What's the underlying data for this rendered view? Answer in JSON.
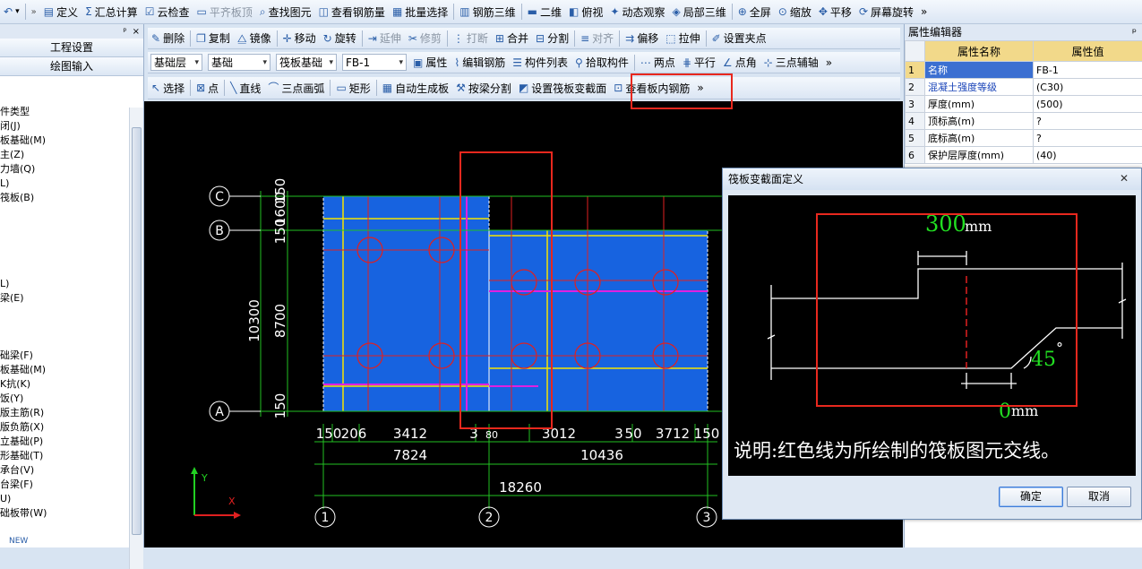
{
  "toolbar1": {
    "items": [
      {
        "label": "定义",
        "icon": "define-icon"
      },
      {
        "label": "汇总计算",
        "icon": "sigma-icon"
      },
      {
        "label": "云检查",
        "icon": "cloud-check-icon"
      },
      {
        "label": "平齐板顶",
        "icon": "align-top-icon",
        "disabled": true
      },
      {
        "label": "查找图元",
        "icon": "find-icon"
      },
      {
        "label": "查看钢筋量",
        "icon": "view-rebar-icon"
      },
      {
        "label": "批量选择",
        "icon": "batch-select-icon"
      },
      {
        "label": "钢筋三维",
        "icon": "rebar-3d-icon"
      },
      {
        "label": "二维",
        "icon": "2d-icon"
      },
      {
        "label": "俯视",
        "icon": "top-view-icon"
      },
      {
        "label": "动态观察",
        "icon": "orbit-icon"
      },
      {
        "label": "局部三维",
        "icon": "local-3d-icon"
      },
      {
        "label": "全屏",
        "icon": "fullscreen-icon"
      },
      {
        "label": "缩放",
        "icon": "zoom-icon"
      },
      {
        "label": "平移",
        "icon": "pan-icon"
      },
      {
        "label": "屏幕旋转",
        "icon": "rotate-screen-icon"
      }
    ],
    "more": "»"
  },
  "toolbar2": {
    "items": [
      {
        "label": "删除",
        "icon": "delete-icon"
      },
      {
        "label": "复制",
        "icon": "copy-icon"
      },
      {
        "label": "镜像",
        "icon": "mirror-icon"
      },
      {
        "label": "移动",
        "icon": "move-icon"
      },
      {
        "label": "旋转",
        "icon": "rotate-icon"
      },
      {
        "label": "延伸",
        "icon": "extend-icon",
        "disabled": true
      },
      {
        "label": "修剪",
        "icon": "trim-icon",
        "disabled": true
      },
      {
        "label": "打断",
        "icon": "break-icon",
        "disabled": true
      },
      {
        "label": "合并",
        "icon": "merge-icon"
      },
      {
        "label": "分割",
        "icon": "split-icon"
      },
      {
        "label": "对齐",
        "icon": "align-icon",
        "disabled": true
      },
      {
        "label": "偏移",
        "icon": "offset-icon"
      },
      {
        "label": "拉伸",
        "icon": "stretch-icon"
      },
      {
        "label": "设置夹点",
        "icon": "grip-icon"
      }
    ]
  },
  "toolbar3": {
    "floor": "基础层",
    "category": "基础",
    "type": "筏板基础",
    "element": "FB-1",
    "items": [
      {
        "label": "属性",
        "icon": "properties-icon"
      },
      {
        "label": "编辑钢筋",
        "icon": "edit-rebar-icon"
      },
      {
        "label": "构件列表",
        "icon": "component-list-icon"
      },
      {
        "label": "拾取构件",
        "icon": "pick-icon"
      },
      {
        "label": "两点",
        "icon": "two-point-icon"
      },
      {
        "label": "平行",
        "icon": "parallel-icon"
      },
      {
        "label": "点角",
        "icon": "point-angle-icon"
      },
      {
        "label": "三点辅轴",
        "icon": "three-point-axis-icon"
      }
    ],
    "more": "»"
  },
  "toolbar4": {
    "items": [
      {
        "label": "选择",
        "icon": "select-cursor-icon"
      },
      {
        "label": "点",
        "icon": "point-icon"
      },
      {
        "label": "直线",
        "icon": "line-icon"
      },
      {
        "label": "三点画弧",
        "icon": "arc-icon"
      },
      {
        "label": "矩形",
        "icon": "rectangle-icon"
      },
      {
        "label": "自动生成板",
        "icon": "auto-slab-icon"
      },
      {
        "label": "按梁分割",
        "icon": "split-by-beam-icon"
      },
      {
        "label": "设置筏板变截面",
        "icon": "variable-section-icon"
      },
      {
        "label": "查看板内钢筋",
        "icon": "view-slab-rebar-icon"
      }
    ],
    "more": "»"
  },
  "leftpanel": {
    "pin": "ᵖ",
    "close": "×",
    "nav": [
      "工程设置",
      "绘图输入"
    ],
    "tree": [
      "件类型",
      "闭(J)",
      "板基础(M)",
      "主(Z)",
      "力墙(Q)",
      "L)",
      "筏板(B)",
      "",
      "",
      "",
      "",
      "",
      "L)",
      "梁(E)",
      "",
      "",
      "",
      "础梁(F)",
      "板基础(M)",
      "K抗(K)",
      "饭(Y)",
      "版主筋(R)",
      "版负筋(X)",
      "立基础(P)",
      "形基础(T)",
      "承台(V)",
      "台梁(F)",
      "U)",
      "础板带(W)"
    ],
    "footer": "NEW"
  },
  "properties": {
    "title": "属性编辑器",
    "pin": "ᵖ",
    "headers": [
      "属性名称",
      "属性值"
    ],
    "rows": [
      {
        "n": "1",
        "name": "名称",
        "value": "FB-1",
        "highlight": false
      },
      {
        "n": "2",
        "name": "混凝土强度等级",
        "value": "(C30)",
        "highlight": true
      },
      {
        "n": "3",
        "name": "厚度(mm)",
        "value": "(500)",
        "highlight": false
      },
      {
        "n": "4",
        "name": "顶标高(m)",
        "value": "?",
        "highlight": false
      },
      {
        "n": "5",
        "name": "底标高(m)",
        "value": "?",
        "highlight": false
      },
      {
        "n": "6",
        "name": "保护层厚度(mm)",
        "value": "(40)",
        "highlight": false
      }
    ]
  },
  "drawing": {
    "axes_rows": [
      "C",
      "B",
      "A"
    ],
    "axes_cols": [
      "1",
      "2",
      "3"
    ],
    "vdims_outer": [
      "10300"
    ],
    "vdims_inner": [
      "1600",
      "150",
      "150",
      "8700",
      "150"
    ],
    "hdims_row1": [
      "150",
      "206",
      "3412",
      "3",
      "80",
      "3012",
      "3",
      "50",
      "3712",
      "150"
    ],
    "hdims_row2": [
      "7824",
      "10436"
    ],
    "hdims_total": "18260",
    "ucs_y": "Y",
    "ucs_x": "X"
  },
  "dialog": {
    "title": "筏板变截面定义",
    "close": "✕",
    "top_offset": "300",
    "top_unit": "mm",
    "angle": "45",
    "angle_unit": "°",
    "bottom_offset": "0",
    "bottom_unit": "mm",
    "note": "说明:红色线为所绘制的筏板图元交线。",
    "ok": "确定",
    "cancel": "取消"
  }
}
